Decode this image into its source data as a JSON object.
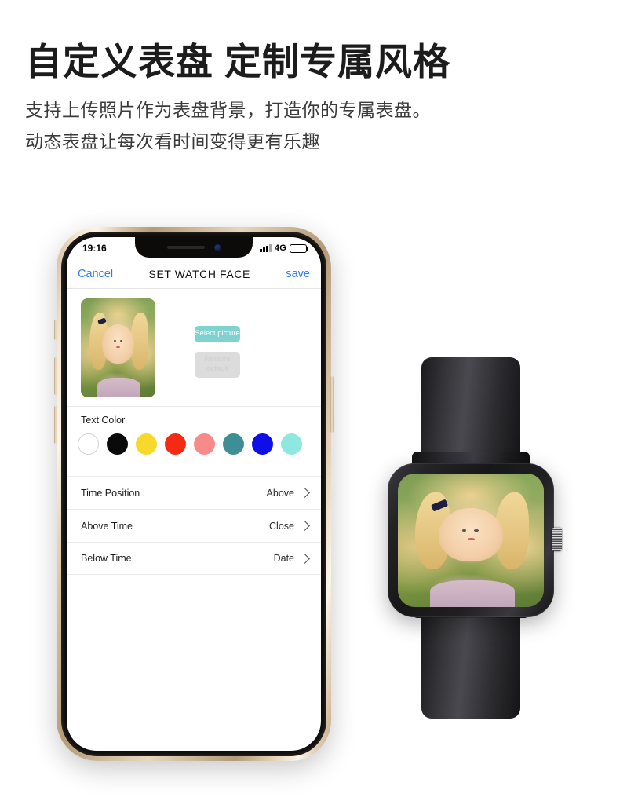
{
  "promo": {
    "headline": "自定义表盘 定制专属风格",
    "subline_1": "支持上传照片作为表盘背景，打造你的专属表盘。",
    "subline_2": "动态表盘让每次看时间变得更有乐趣"
  },
  "phone": {
    "status_bar": {
      "time": "19:16",
      "network": "4G",
      "signal_icon": "signal-bars-icon",
      "battery_icon": "battery-icon"
    },
    "nav_bar": {
      "cancel_label": "Cancel",
      "title": "SET WATCH FACE",
      "save_label": "save"
    },
    "picture_section": {
      "preview_name": "watch-face-preview-photo",
      "select_button": "Select picture",
      "restore_button": "Restore default",
      "select_button_color": "#7ED3D0",
      "restore_button_color": "#DCDCDC"
    },
    "text_color": {
      "label": "Text Color",
      "swatches": [
        {
          "name": "white",
          "hex": "#FFFFFF",
          "outlined": true
        },
        {
          "name": "black",
          "hex": "#0A0A0A",
          "outlined": false
        },
        {
          "name": "yellow",
          "hex": "#F8D92B",
          "outlined": false
        },
        {
          "name": "red",
          "hex": "#F42A12",
          "outlined": false
        },
        {
          "name": "pink",
          "hex": "#F98A8A",
          "outlined": false
        },
        {
          "name": "teal",
          "hex": "#3E8E96",
          "outlined": false
        },
        {
          "name": "blue",
          "hex": "#0E0EE8",
          "outlined": false
        },
        {
          "name": "aqua",
          "hex": "#8EE8E0",
          "outlined": false
        }
      ]
    },
    "settings_rows": [
      {
        "label": "Time Position",
        "value": "Above"
      },
      {
        "label": "Above Time",
        "value": "Close"
      },
      {
        "label": "Below Time",
        "value": "Date"
      }
    ]
  },
  "watch": {
    "name": "smartwatch-product-render",
    "case_color": "#1B1B1E",
    "strap_color": "#242428",
    "face_name": "watch-face-photo",
    "crown_icon": "crown-button-icon"
  }
}
